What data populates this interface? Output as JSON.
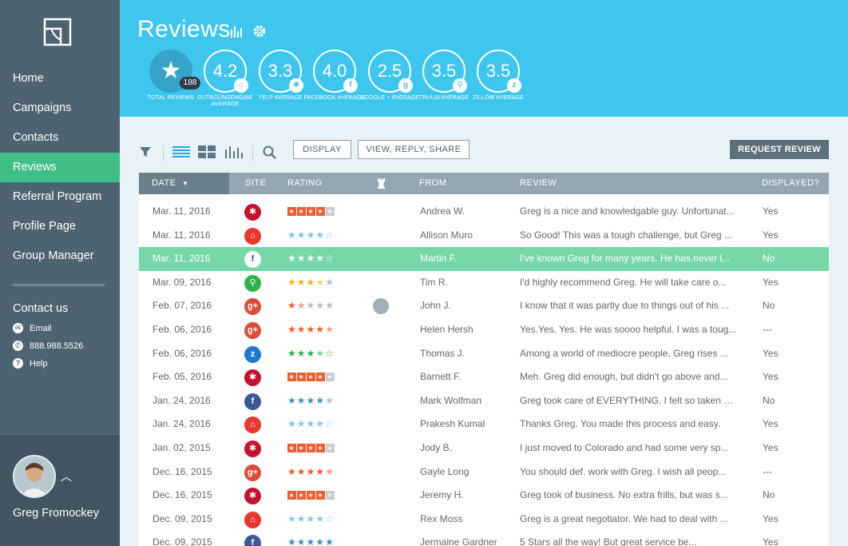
{
  "sidebar": {
    "nav": [
      {
        "label": "Home",
        "active": false
      },
      {
        "label": "Campaigns",
        "active": false
      },
      {
        "label": "Contacts",
        "active": false
      },
      {
        "label": "Reviews",
        "active": true
      },
      {
        "label": "Referral Program",
        "active": false
      },
      {
        "label": "Profile Page",
        "active": false
      },
      {
        "label": "Group Manager",
        "active": false
      }
    ],
    "contact_title": "Contact us",
    "email_label": "Email",
    "phone_label": "888.988.5526",
    "help_label": "Help",
    "user_name": "Greg Fromockey"
  },
  "header": {
    "title": "Reviews",
    "stats": [
      {
        "value": "",
        "badge": "188",
        "label": "TOTAL REVIEWS",
        "icon": "star-icon"
      },
      {
        "value": "4.2",
        "label": "OUTBOUNDENGINE AVERAGE",
        "icon": "outboundengine-icon"
      },
      {
        "value": "3.3",
        "label": "YELP AVERAGE",
        "icon": "yelp-icon"
      },
      {
        "value": "4.0",
        "label": "FACEBOOK AVERAGE",
        "icon": "facebook-icon"
      },
      {
        "value": "2.5",
        "label": "GOOGLE + AVERAGE",
        "icon": "google-plus-icon"
      },
      {
        "value": "3.5",
        "label": "TRULIA AVERAGE",
        "icon": "trulia-icon"
      },
      {
        "value": "3.5",
        "label": "ZILLOW AVERAGE",
        "icon": "zillow-icon"
      }
    ]
  },
  "toolbar": {
    "display_label": "DISPLAY",
    "view_reply_share_label": "VIEW, REPLY, SHARE",
    "request_review_label": "REQUEST REVIEW"
  },
  "table": {
    "headers": {
      "date": "DATE",
      "site": "SITE",
      "rating": "RATING",
      "from": "FROM",
      "review": "REVIEW",
      "displayed": "DISPLAYED?"
    },
    "rows": [
      {
        "date": "Mar. 11, 2016",
        "site": "yelp",
        "rating": 4,
        "from": "Andrea W.",
        "review": "Greg is a nice and knowledgable guy. Unfortunat...",
        "displayed": "Yes",
        "flag": false,
        "selected": false
      },
      {
        "date": "Mar. 11, 2016",
        "site": "outboundengine",
        "rating": 4,
        "from": "Allison Muro",
        "review": "So Good! This was a tough challenge, but Greg ...",
        "displayed": "Yes",
        "flag": false,
        "selected": false
      },
      {
        "date": "Mar. 11, 2016",
        "site": "facebook",
        "rating": 4,
        "from": "Martin F.",
        "review": "I've known Greg for many years. He has never l...",
        "displayed": "No",
        "flag": false,
        "selected": true
      },
      {
        "date": "Mar. 09, 2016",
        "site": "trulia",
        "rating": 3.5,
        "from": "Tim R.",
        "review": "I'd highly recommend Greg. He will take care o...",
        "displayed": "Yes",
        "flag": false,
        "selected": false
      },
      {
        "date": "Feb. 07, 2016",
        "site": "google",
        "rating": 1.5,
        "from": "John J.",
        "review": "I know that it was partly due to things out of his ...",
        "displayed": "No",
        "flag": true,
        "selected": false
      },
      {
        "date": "Feb. 06, 2016",
        "site": "google",
        "rating": 4.5,
        "from": "Helen Hersh",
        "review": "Yes.Yes. Yes. He was soooo helpful. I was a toug...",
        "displayed": "---",
        "flag": false,
        "selected": false
      },
      {
        "date": "Feb. 06, 2016",
        "site": "zillow",
        "rating": 3.5,
        "from": "Thomas J.",
        "review": "Among a world of mediocre people, Greg rises ...",
        "displayed": "Yes",
        "flag": false,
        "selected": false
      },
      {
        "date": "Feb. 05, 2016",
        "site": "yelp",
        "rating": 4,
        "from": "Barnett F.",
        "review": "Meh. Greg did enough, but didn't go above and...",
        "displayed": "Yes",
        "flag": false,
        "selected": false
      },
      {
        "date": "Jan. 24, 2016",
        "site": "facebook",
        "rating": 4,
        "from": "Mark Wolfman",
        "review": "Greg took care of EVERYTHING. I felt so taken ca...",
        "displayed": "No",
        "flag": false,
        "selected": false
      },
      {
        "date": "Jan. 24, 2016",
        "site": "outboundengine",
        "rating": 4,
        "from": "Prakesh Kumal",
        "review": "Thanks Greg. You made this process and easy.",
        "displayed": "Yes",
        "flag": false,
        "selected": false
      },
      {
        "date": "Jan. 02, 2015",
        "site": "yelp",
        "rating": 4,
        "from": "Jody B.",
        "review": "I just moved to Colorado and had some very sp...",
        "displayed": "Yes",
        "flag": false,
        "selected": false
      },
      {
        "date": "Dec. 16, 2015",
        "site": "google",
        "rating": 4.5,
        "from": "Gayle Long",
        "review": "You should def. work with Greg. I wish all peop...",
        "displayed": "---",
        "flag": false,
        "selected": false
      },
      {
        "date": "Dec. 16, 2015",
        "site": "yelp",
        "rating": 4,
        "from": "Jeremy H.",
        "review": "Greg took of business. No extra frills, but was s...",
        "displayed": "No",
        "flag": false,
        "selected": false
      },
      {
        "date": "Dec. 09, 2015",
        "site": "outboundengine",
        "rating": 4,
        "from": "Rex Moss",
        "review": "Greg is a great negotiator. We had to deal with ...",
        "displayed": "Yes",
        "flag": false,
        "selected": false
      },
      {
        "date": "Dec. 09, 2015",
        "site": "facebook",
        "rating": 5,
        "from": "Jermaine Gardner",
        "review": "5 Stars all the way! But great service be...",
        "displayed": "Yes",
        "flag": false,
        "selected": false
      }
    ]
  },
  "colors": {
    "sidebar": "#4d6371",
    "header": "#3ec6ef",
    "active_nav": "#3fbf86",
    "selected_row": "#77d7a8",
    "yelp": "#c41230",
    "outboundengine": "#e8372f",
    "facebook": "#3b5998",
    "google": "#dd4b39",
    "trulia": "#30b24a",
    "zillow": "#1e78d4"
  }
}
